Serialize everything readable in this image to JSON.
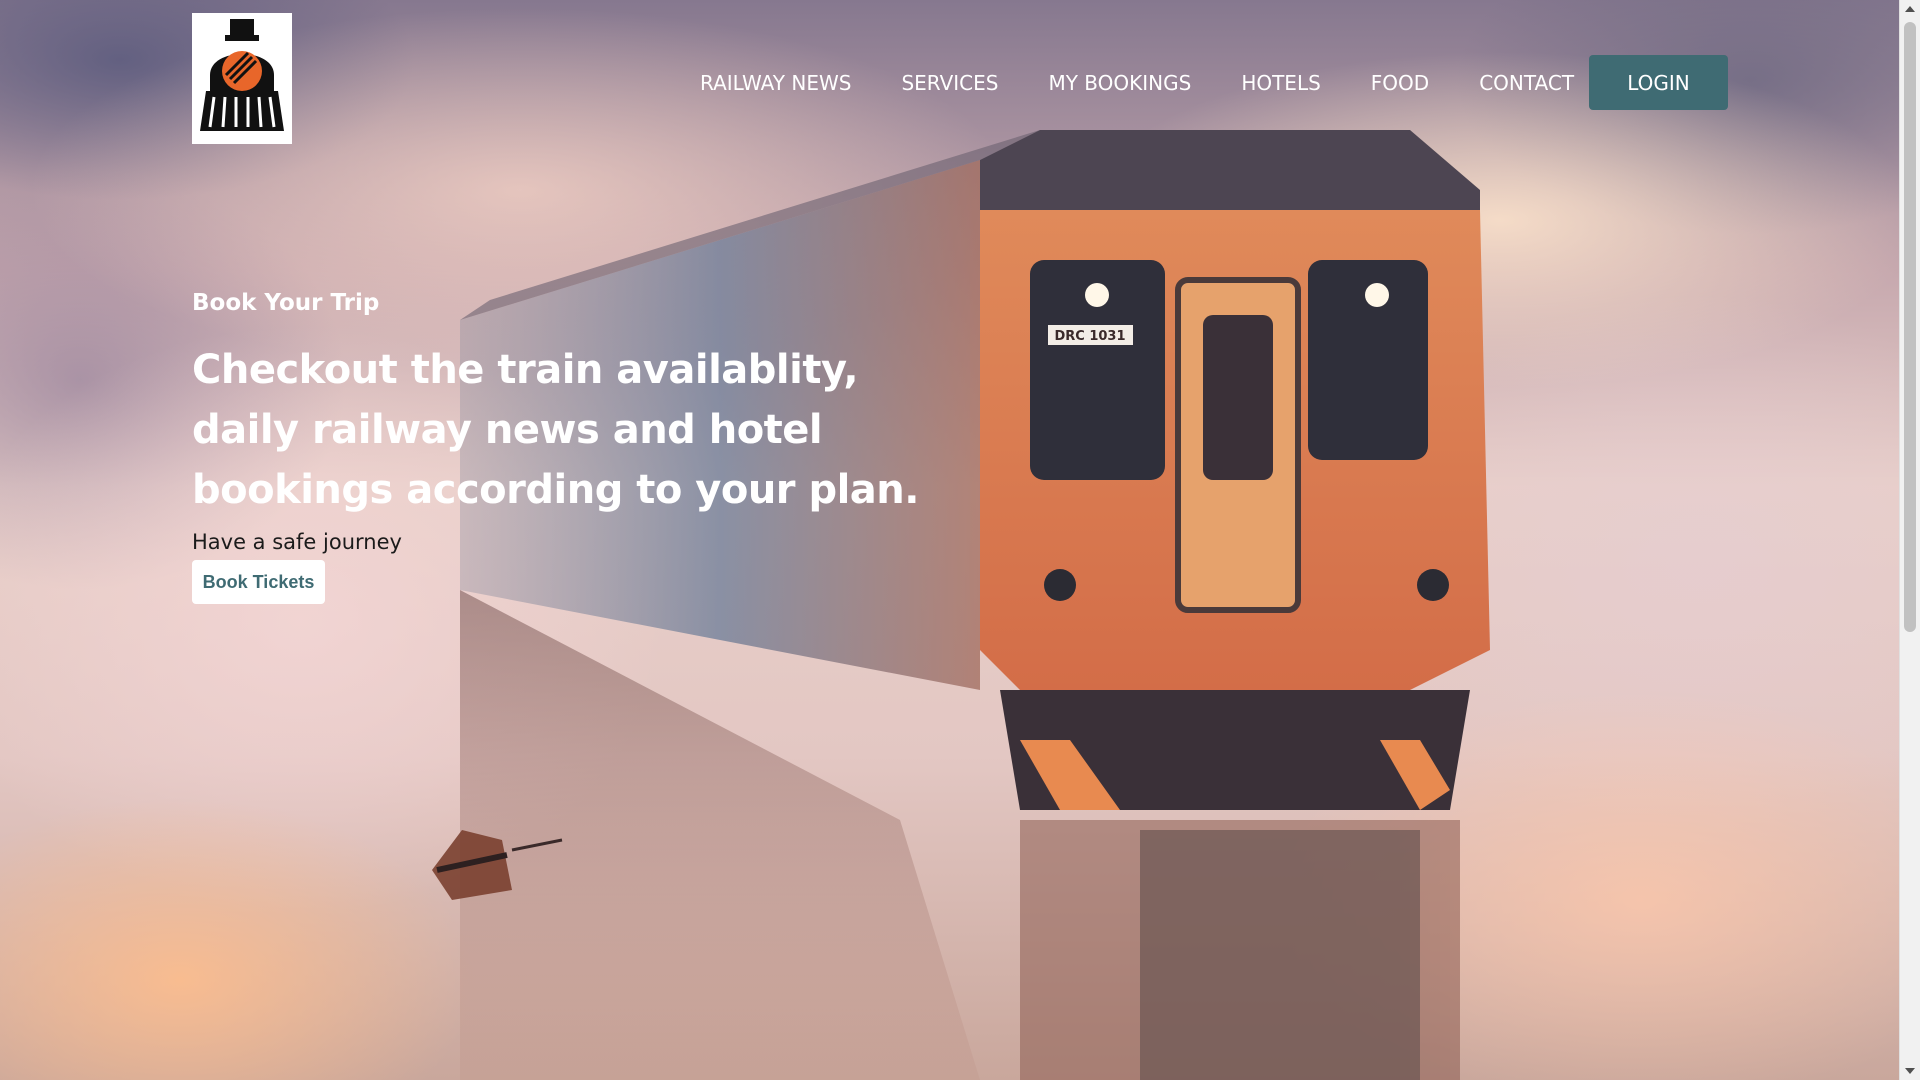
{
  "header": {
    "logo_icon": "steam-locomotive-icon",
    "nav": [
      {
        "label": "RAILWAY NEWS"
      },
      {
        "label": "SERVICES"
      },
      {
        "label": "MY BOOKINGS"
      },
      {
        "label": "HOTELS"
      },
      {
        "label": "FOOD"
      },
      {
        "label": "CONTACT"
      }
    ],
    "login_label": "LOGIN"
  },
  "hero": {
    "kicker": "Book Your Trip",
    "headline": "Checkout the train availablity, daily railway news and hotel bookings according to your plan.",
    "subtext": "Have a safe journey",
    "cta_label": "Book Tickets",
    "train_number": "DRC 1031"
  },
  "colors": {
    "accent": "#3f6b73",
    "logo_orange": "#e8662a",
    "text_light": "#ffffff",
    "text_dark": "#1b1b1b"
  }
}
